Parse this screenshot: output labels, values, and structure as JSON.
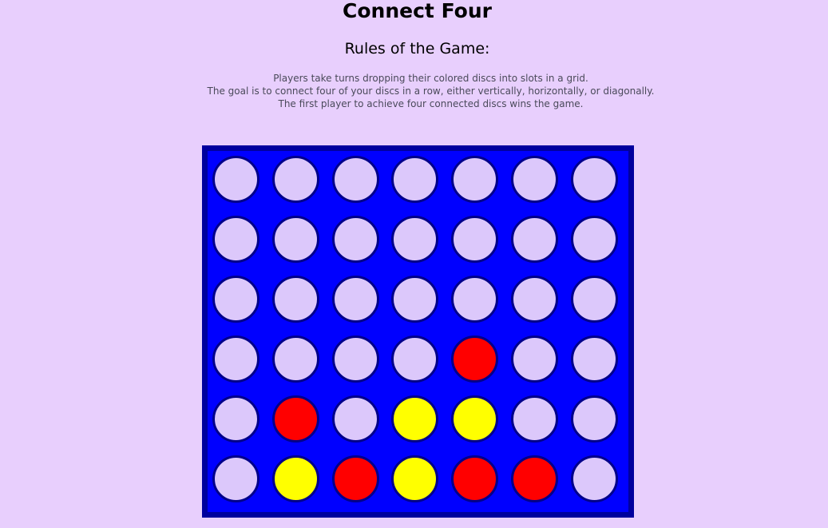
{
  "header": {
    "title": "Connect Four",
    "rules_heading": "Rules of the Game:",
    "rules_lines": [
      "Players take turns dropping their colored discs into slots in a grid.",
      "The goal is to connect four of your discs in a row, either vertically, horizontally, or diagonally.",
      "The first player to achieve four connected discs wins the game."
    ]
  },
  "colors": {
    "page_background": "#e8cffd",
    "board": "#0000ff",
    "board_border": "#00009e",
    "empty": "#dcc8fb",
    "red": "#ff0000",
    "yellow": "#ffff00"
  },
  "board": {
    "rows": 6,
    "columns": 7,
    "cells": [
      [
        "empty",
        "empty",
        "empty",
        "empty",
        "empty",
        "empty",
        "empty"
      ],
      [
        "empty",
        "empty",
        "empty",
        "empty",
        "empty",
        "empty",
        "empty"
      ],
      [
        "empty",
        "empty",
        "empty",
        "empty",
        "empty",
        "empty",
        "empty"
      ],
      [
        "empty",
        "empty",
        "empty",
        "empty",
        "red",
        "empty",
        "empty"
      ],
      [
        "empty",
        "red",
        "empty",
        "yellow",
        "yellow",
        "empty",
        "empty"
      ],
      [
        "empty",
        "yellow",
        "red",
        "yellow",
        "red",
        "red",
        "empty"
      ]
    ]
  }
}
